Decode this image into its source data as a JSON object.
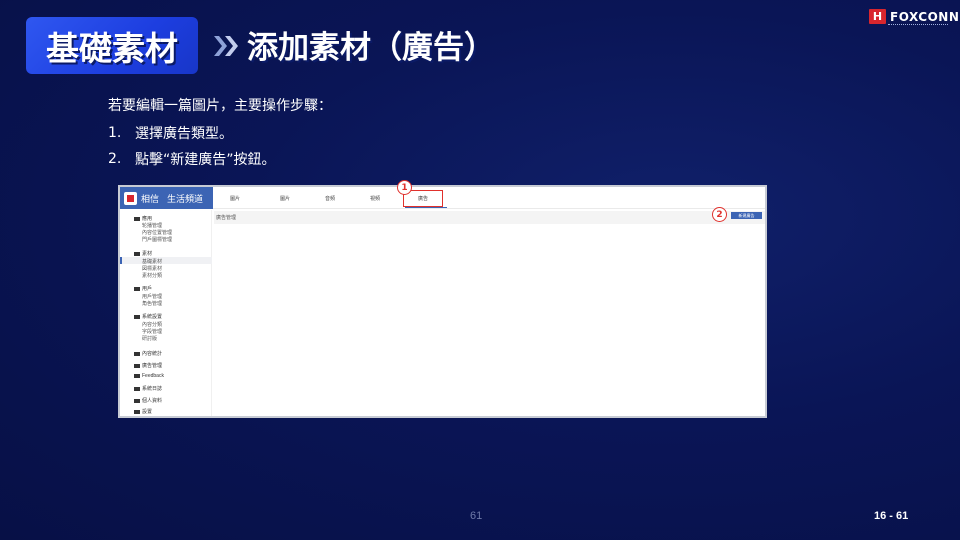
{
  "header": {
    "title": "基礎素材",
    "subtitle": "添加素材（廣告）",
    "logo_mark": "H",
    "logo_text": "FOXCONN"
  },
  "instructions": {
    "intro": "若要編輯一篇圖片，主要操作步驟：",
    "steps": [
      {
        "num": "1.",
        "text": "選擇廣告類型。"
      },
      {
        "num": "2.",
        "text": "點擊“新建廣告”按鈕。"
      }
    ]
  },
  "screenshot": {
    "brand_name": "相信",
    "brand_sub": "生活頻道",
    "nav": [
      "圖片",
      "圖片",
      "音頻",
      "視頻",
      "廣告"
    ],
    "callouts": [
      "1",
      "2"
    ],
    "breadcrumb": "廣告管理",
    "new_button": "新建廣告",
    "sidebar": [
      {
        "group": "應用",
        "items": [
          "轮播管理",
          "內容位置管理",
          "門戶圖標管理"
        ]
      },
      {
        "group": "素材",
        "items": [
          "基礎素材",
          "図標素材",
          "素材分類"
        ]
      },
      {
        "group": "用戶",
        "items": [
          "用戶管理",
          "角色管理"
        ]
      },
      {
        "group": "系統設置",
        "items": [
          "內容分類",
          "字段管理",
          "研討版"
        ]
      },
      {
        "group": "內容統計",
        "items": []
      },
      {
        "group": "廣告管理",
        "items": []
      },
      {
        "group": "Feedback",
        "items": []
      },
      {
        "group": "系統日誌",
        "items": []
      },
      {
        "group": "個人資料",
        "items": []
      },
      {
        "group": "設置",
        "items": []
      }
    ]
  },
  "footer": {
    "page_center": "61",
    "page_right": "16 - 61"
  },
  "colors": {
    "background": "#0a1556",
    "title_pill": "#2449ea",
    "brand_blue": "#3c64b4",
    "callout_red": "#e0312c"
  }
}
